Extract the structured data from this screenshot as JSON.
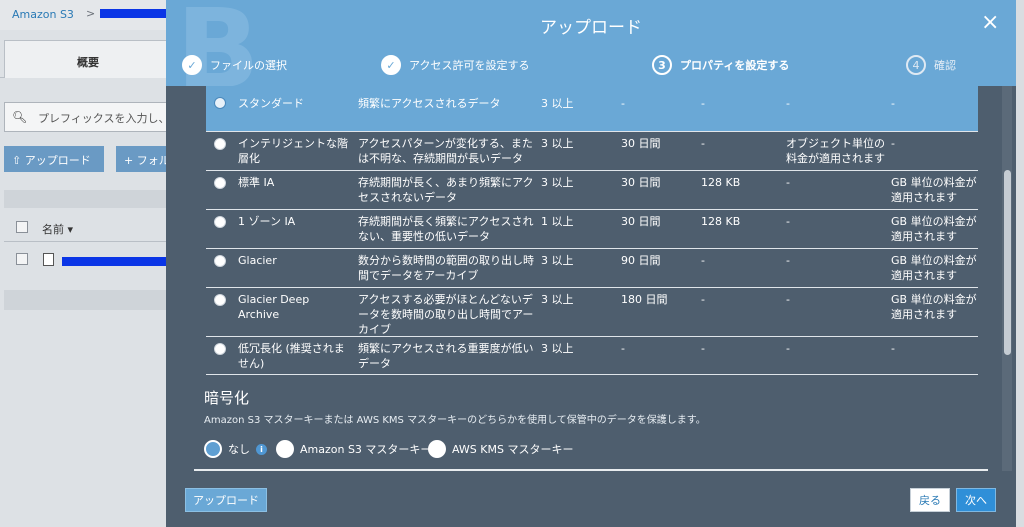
{
  "background": {
    "breadcrumb_root": "Amazon S3",
    "breadcrumb_sep": ">",
    "tab_overview": "概要",
    "search_placeholder": "プレフィックスを入力し、",
    "upload_button": "アップロード",
    "folder_button": "フォル",
    "column_name": "名前 ▾"
  },
  "modal": {
    "title": "アップロード",
    "close": "×",
    "watermark": "B",
    "steps": [
      {
        "number": "✓",
        "label": "ファイルの選択",
        "state": "done"
      },
      {
        "number": "✓",
        "label": "アクセス許可を設定する",
        "state": "done"
      },
      {
        "number": "3",
        "label": "プロパティを設定する",
        "state": "active"
      },
      {
        "number": "4",
        "label": "確認",
        "state": "pending"
      }
    ]
  },
  "storage_classes": [
    {
      "name": "スタンダード",
      "description": "頻繁にアクセスされるデータ",
      "az": "3 以上",
      "min_duration": "-",
      "min_size": "-",
      "monitoring": "-",
      "retrieval": "-",
      "selected": true
    },
    {
      "name": "インテリジェントな階層化",
      "description": "アクセスパターンが変化する、または不明な、存続期間が長いデータ",
      "az": "3 以上",
      "min_duration": "30 日間",
      "min_size": "-",
      "monitoring": "オブジェクト単位の料金が適用されます",
      "retrieval": "-",
      "selected": false
    },
    {
      "name": "標準 IA",
      "description": "存続期間が長く、あまり頻繁にアクセスされないデータ",
      "az": "3 以上",
      "min_duration": "30 日間",
      "min_size": "128 KB",
      "monitoring": "-",
      "retrieval": "GB 単位の料金が適用されます",
      "selected": false
    },
    {
      "name": "1 ゾーン IA",
      "description": "存続期間が長く頻繁にアクセスされない、重要性の低いデータ",
      "az": "1 以上",
      "min_duration": "30 日間",
      "min_size": "128 KB",
      "monitoring": "-",
      "retrieval": "GB 単位の料金が適用されます",
      "selected": false
    },
    {
      "name": "Glacier",
      "description": "数分から数時間の範囲の取り出し時間でデータをアーカイブ",
      "az": "3 以上",
      "min_duration": "90 日間",
      "min_size": "-",
      "monitoring": "-",
      "retrieval": "GB 単位の料金が適用されます",
      "selected": false
    },
    {
      "name": "Glacier Deep Archive",
      "description": "アクセスする必要がほとんどないデータを数時間の取り出し時間でアーカイブ",
      "az": "3 以上",
      "min_duration": "180 日間",
      "min_size": "-",
      "monitoring": "-",
      "retrieval": "GB 単位の料金が適用されます",
      "selected": false
    },
    {
      "name": "低冗長化 (推奨されません)",
      "description": "頻繁にアクセスされる重要度が低いデータ",
      "az": "3 以上",
      "min_duration": "-",
      "min_size": "-",
      "monitoring": "-",
      "retrieval": "-",
      "selected": false
    }
  ],
  "encryption": {
    "title": "暗号化",
    "description": "Amazon S3 マスターキーまたは AWS KMS マスターキーのどちらかを使用して保管中のデータを保護します。",
    "options": [
      {
        "label": "なし",
        "selected": true,
        "info": "i"
      },
      {
        "label": "Amazon S3 マスターキー",
        "selected": false
      },
      {
        "label": "AWS KMS マスターキー",
        "selected": false
      }
    ]
  },
  "footer": {
    "upload": "アップロード",
    "back": "戻る",
    "next": "次へ"
  },
  "colors": {
    "header_blue": "#6aa8d6",
    "modal_bg": "#4e5e6e",
    "primary_button": "#2f8fd8"
  }
}
